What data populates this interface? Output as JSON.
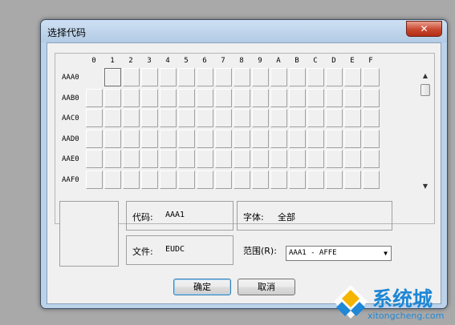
{
  "window": {
    "title": "选择代码",
    "close_label": "✕"
  },
  "grid": {
    "columns": [
      "0",
      "1",
      "2",
      "3",
      "4",
      "5",
      "6",
      "7",
      "8",
      "9",
      "A",
      "B",
      "C",
      "D",
      "E",
      "F"
    ],
    "rows": [
      "AAA0",
      "AAB0",
      "AAC0",
      "AAD0",
      "AAE0",
      "AAF0"
    ],
    "selected_code": "AAA1"
  },
  "scrollbar": {
    "up_arrow": "▲",
    "down_arrow": "▼"
  },
  "info": {
    "code_label": "代码:",
    "code_value": "AAA1",
    "font_label": "字体:",
    "font_value": "全部",
    "file_label": "文件:",
    "file_value": "EUDC",
    "range_label": "范围(R):",
    "range_value": "AAA1 - AFFE",
    "range_arrow": "▼"
  },
  "buttons": {
    "ok_label": "确定",
    "cancel_label": "取消"
  },
  "watermark": {
    "brand": "系统城",
    "url": "xitongcheng.com"
  },
  "colors": {
    "window_frame": "#bcd2ea",
    "close_button": "#c9472f",
    "watermark_blue": "#1e87d6"
  }
}
